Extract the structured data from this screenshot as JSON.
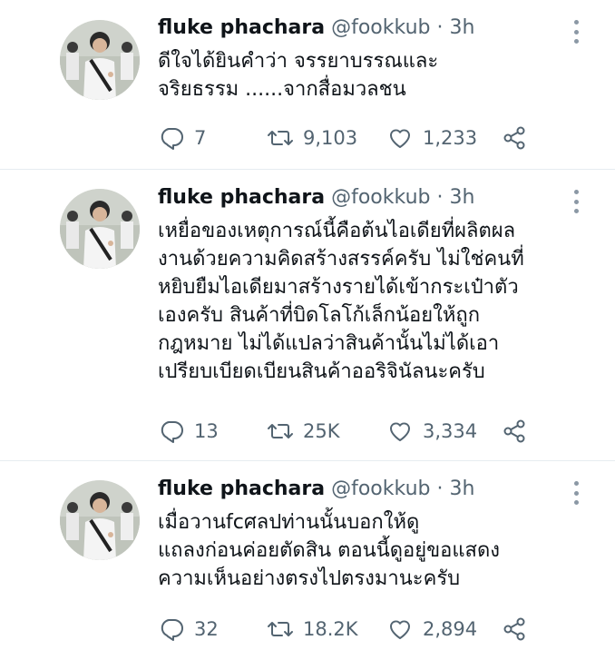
{
  "tweets": [
    {
      "name": "fluke phachara",
      "handle": "@fookkub",
      "time": "· 3h",
      "text": "ดีใจได้ยินคำว่า จรรยาบรรณและ\nจริยธรรม ......จากสื่อมวลชน",
      "replies": "7",
      "retweets": "9,103",
      "likes": "1,233"
    },
    {
      "name": "fluke phachara",
      "handle": "@fookkub",
      "time": "· 3h",
      "text": "เหยื่อของเหตุการณ์นี้คือต้นไอเดียที่ผลิตผล\nงานด้วยความคิดสร้างสรรค์ครับ ไม่ใช่คนที่\nหยิบยืมไอเดียมาสร้างรายได้เข้ากระเป๋าตัว\nเองครับ สินค้าที่บิดโลโก้เล็กน้อยให้ถูก\nกฎหมาย ไม่ได้แปลว่าสินค้านั้นไม่ได้เอา\nเปรียบเบียดเบียนสินค้าออริจินัลนะครับ",
      "replies": "13",
      "retweets": "25K",
      "likes": "3,334"
    },
    {
      "name": "fluke phachara",
      "handle": "@fookkub",
      "time": "· 3h",
      "text": "เมื่อวานfcศลปท่านนั้นบอกให้ดู\nแถลงก่อนค่อยตัดสิน ตอนนี้ดูอยู่ขอแสดง\nความเห็นอย่างตรงไปตรงมานะครับ",
      "replies": "32",
      "retweets": "18.2K",
      "likes": "2,894"
    }
  ],
  "icons": {
    "reply": "reply-icon",
    "retweet": "retweet-icon",
    "like": "heart-icon",
    "share": "share-icon",
    "more": "more-vertical-icon"
  },
  "colors": {
    "icon_gray": "#536471",
    "name": "#0f1419",
    "divider": "#e6ecf0"
  }
}
